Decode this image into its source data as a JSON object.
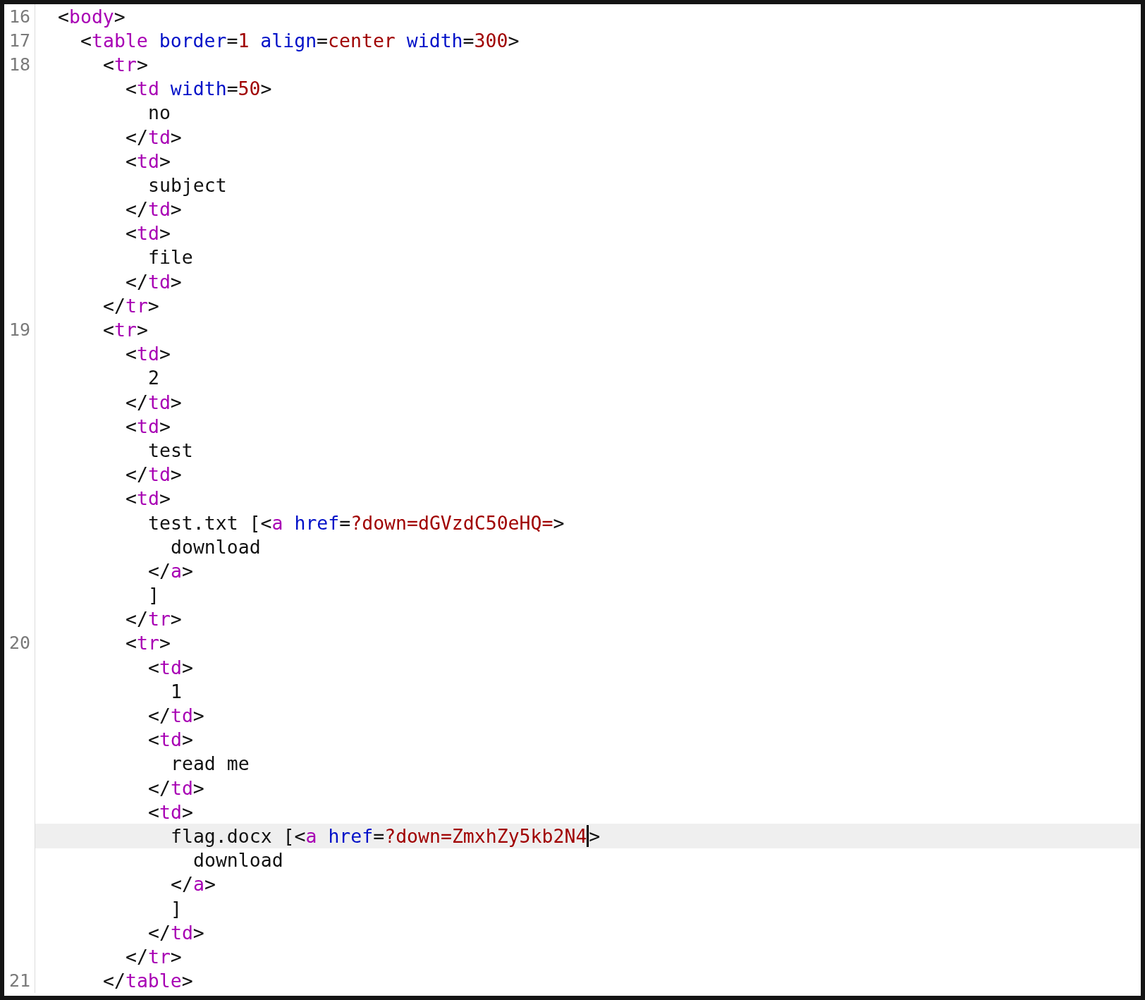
{
  "editor": {
    "lines": [
      {
        "number": "16",
        "current": false,
        "tokens": [
          {
            "kind": "plain",
            "text": "<"
          },
          {
            "kind": "tag",
            "text": "body"
          },
          {
            "kind": "plain",
            "text": ">"
          }
        ],
        "children": [
          {
            "number": "17",
            "current": false,
            "tokens": [
              {
                "kind": "plain",
                "text": "<"
              },
              {
                "kind": "tag",
                "text": "table"
              },
              {
                "kind": "attr",
                "text": "border"
              },
              {
                "kind": "plain",
                "text": "="
              },
              {
                "kind": "value",
                "text": "1"
              },
              {
                "kind": "attr",
                "text": "align"
              },
              {
                "kind": "plain",
                "text": "="
              },
              {
                "kind": "value",
                "text": "center"
              },
              {
                "kind": "attr",
                "text": "width"
              },
              {
                "kind": "plain",
                "text": "="
              },
              {
                "kind": "value",
                "text": "300"
              },
              {
                "kind": "plain",
                "text": ">"
              }
            ],
            "children": [
              {
                "number": "18",
                "current": false,
                "tokens": [
                  {
                    "kind": "plain",
                    "text": "<"
                  },
                  {
                    "kind": "tag",
                    "text": "tr"
                  },
                  {
                    "kind": "plain",
                    "text": ">"
                  }
                ],
                "children": [
                  {
                    "current": false,
                    "tokens": [
                      {
                        "kind": "plain",
                        "text": "<"
                      },
                      {
                        "kind": "tag",
                        "text": "td"
                      },
                      {
                        "kind": "attr",
                        "text": "width"
                      },
                      {
                        "kind": "plain",
                        "text": "="
                      },
                      {
                        "kind": "value",
                        "text": "50"
                      },
                      {
                        "kind": "plain",
                        "text": ">"
                      }
                    ],
                    "children": [
                      {
                        "current": false,
                        "tokens": [
                          {
                            "kind": "plain",
                            "text": "no"
                          }
                        ]
                      }
                    ]
                  },
                  {
                    "current": false,
                    "tokens": [
                      {
                        "kind": "plain",
                        "text": "</"
                      },
                      {
                        "kind": "tag",
                        "text": "td"
                      },
                      {
                        "kind": "plain",
                        "text": ">"
                      }
                    ]
                  },
                  {
                    "current": false,
                    "tokens": [
                      {
                        "kind": "plain",
                        "text": "<"
                      },
                      {
                        "kind": "tag",
                        "text": "td"
                      },
                      {
                        "kind": "plain",
                        "text": ">"
                      }
                    ],
                    "children": [
                      {
                        "current": false,
                        "tokens": [
                          {
                            "kind": "plain",
                            "text": "subject"
                          }
                        ]
                      }
                    ]
                  },
                  {
                    "current": false,
                    "tokens": [
                      {
                        "kind": "plain",
                        "text": "</"
                      },
                      {
                        "kind": "tag",
                        "text": "td"
                      },
                      {
                        "kind": "plain",
                        "text": ">"
                      }
                    ]
                  },
                  {
                    "current": false,
                    "tokens": [
                      {
                        "kind": "plain",
                        "text": "<"
                      },
                      {
                        "kind": "tag",
                        "text": "td"
                      },
                      {
                        "kind": "plain",
                        "text": ">"
                      }
                    ],
                    "children": [
                      {
                        "current": false,
                        "tokens": [
                          {
                            "kind": "plain",
                            "text": "file"
                          }
                        ]
                      }
                    ]
                  },
                  {
                    "current": false,
                    "tokens": [
                      {
                        "kind": "plain",
                        "text": "</"
                      },
                      {
                        "kind": "tag",
                        "text": "td"
                      },
                      {
                        "kind": "plain",
                        "text": ">"
                      }
                    ]
                  }
                ]
              },
              {
                "current": false,
                "tokens": [
                  {
                    "kind": "plain",
                    "text": "</"
                  },
                  {
                    "kind": "tag",
                    "text": "tr"
                  },
                  {
                    "kind": "plain",
                    "text": ">"
                  }
                ]
              },
              {
                "number": "19",
                "current": false,
                "tokens": [
                  {
                    "kind": "plain",
                    "text": "<"
                  },
                  {
                    "kind": "tag",
                    "text": "tr"
                  },
                  {
                    "kind": "plain",
                    "text": ">"
                  }
                ],
                "children": [
                  {
                    "current": false,
                    "tokens": [
                      {
                        "kind": "plain",
                        "text": "<"
                      },
                      {
                        "kind": "tag",
                        "text": "td"
                      },
                      {
                        "kind": "plain",
                        "text": ">"
                      }
                    ],
                    "children": [
                      {
                        "current": false,
                        "tokens": [
                          {
                            "kind": "plain",
                            "text": "2"
                          }
                        ]
                      }
                    ]
                  },
                  {
                    "current": false,
                    "tokens": [
                      {
                        "kind": "plain",
                        "text": "</"
                      },
                      {
                        "kind": "tag",
                        "text": "td"
                      },
                      {
                        "kind": "plain",
                        "text": ">"
                      }
                    ]
                  },
                  {
                    "current": false,
                    "tokens": [
                      {
                        "kind": "plain",
                        "text": "<"
                      },
                      {
                        "kind": "tag",
                        "text": "td"
                      },
                      {
                        "kind": "plain",
                        "text": ">"
                      }
                    ],
                    "children": [
                      {
                        "current": false,
                        "tokens": [
                          {
                            "kind": "plain",
                            "text": "test"
                          }
                        ]
                      }
                    ]
                  },
                  {
                    "current": false,
                    "tokens": [
                      {
                        "kind": "plain",
                        "text": "</"
                      },
                      {
                        "kind": "tag",
                        "text": "td"
                      },
                      {
                        "kind": "plain",
                        "text": ">"
                      }
                    ]
                  },
                  {
                    "current": false,
                    "tokens": [
                      {
                        "kind": "plain",
                        "text": "<"
                      },
                      {
                        "kind": "tag",
                        "text": "td"
                      },
                      {
                        "kind": "plain",
                        "text": ">"
                      }
                    ],
                    "children": [
                      {
                        "current": false,
                        "tokens": [
                          {
                            "kind": "plain",
                            "text": "test.txt [<"
                          },
                          {
                            "kind": "tag",
                            "text": "a"
                          },
                          {
                            "kind": "attr",
                            "text": "href"
                          },
                          {
                            "kind": "plain",
                            "text": "="
                          },
                          {
                            "kind": "value",
                            "text": "?down=dGVzdC50eHQ="
                          },
                          {
                            "kind": "plain",
                            "text": ">"
                          }
                        ],
                        "children": [
                          {
                            "current": false,
                            "tokens": [
                              {
                                "kind": "plain",
                                "text": "download"
                              }
                            ]
                          }
                        ]
                      },
                      {
                        "current": false,
                        "tokens": [
                          {
                            "kind": "plain",
                            "text": "</"
                          },
                          {
                            "kind": "tag",
                            "text": "a"
                          },
                          {
                            "kind": "plain",
                            "text": ">"
                          }
                        ]
                      },
                      {
                        "current": false,
                        "tokens": [
                          {
                            "kind": "plain",
                            "text": "]"
                          }
                        ]
                      }
                    ]
                  },
                  {
                    "current": false,
                    "tokens": [
                      {
                        "kind": "plain",
                        "text": "</"
                      },
                      {
                        "kind": "tag",
                        "text": "tr"
                      },
                      {
                        "kind": "plain",
                        "text": ">"
                      }
                    ]
                  },
                  {
                    "number": "20",
                    "current": false,
                    "tokens": [
                      {
                        "kind": "plain",
                        "text": "<"
                      },
                      {
                        "kind": "tag",
                        "text": "tr"
                      },
                      {
                        "kind": "plain",
                        "text": ">"
                      }
                    ],
                    "children": [
                      {
                        "current": false,
                        "tokens": [
                          {
                            "kind": "plain",
                            "text": "<"
                          },
                          {
                            "kind": "tag",
                            "text": "td"
                          },
                          {
                            "kind": "plain",
                            "text": ">"
                          }
                        ],
                        "children": [
                          {
                            "current": false,
                            "tokens": [
                              {
                                "kind": "plain",
                                "text": "1"
                              }
                            ]
                          }
                        ]
                      },
                      {
                        "current": false,
                        "tokens": [
                          {
                            "kind": "plain",
                            "text": "</"
                          },
                          {
                            "kind": "tag",
                            "text": "td"
                          },
                          {
                            "kind": "plain",
                            "text": ">"
                          }
                        ]
                      },
                      {
                        "current": false,
                        "tokens": [
                          {
                            "kind": "plain",
                            "text": "<"
                          },
                          {
                            "kind": "tag",
                            "text": "td"
                          },
                          {
                            "kind": "plain",
                            "text": ">"
                          }
                        ],
                        "children": [
                          {
                            "current": false,
                            "tokens": [
                              {
                                "kind": "plain",
                                "text": "read me"
                              }
                            ]
                          }
                        ]
                      },
                      {
                        "current": false,
                        "tokens": [
                          {
                            "kind": "plain",
                            "text": "</"
                          },
                          {
                            "kind": "tag",
                            "text": "td"
                          },
                          {
                            "kind": "plain",
                            "text": ">"
                          }
                        ]
                      },
                      {
                        "current": false,
                        "tokens": [
                          {
                            "kind": "plain",
                            "text": "<"
                          },
                          {
                            "kind": "tag",
                            "text": "td"
                          },
                          {
                            "kind": "plain",
                            "text": ">"
                          }
                        ],
                        "children": [
                          {
                            "current": true,
                            "tokens": [
                              {
                                "kind": "plain",
                                "text": "flag.docx [<"
                              },
                              {
                                "kind": "tag",
                                "text": "a"
                              },
                              {
                                "kind": "attr",
                                "text": "href"
                              },
                              {
                                "kind": "plain",
                                "text": "="
                              },
                              {
                                "kind": "value",
                                "text": "?down=ZmxhZy5kb2N4",
                                "caret_after": true
                              },
                              {
                                "kind": "plain",
                                "text": ">"
                              }
                            ],
                            "children": [
                              {
                                "current": false,
                                "tokens": [
                                  {
                                    "kind": "plain",
                                    "text": "download"
                                  }
                                ]
                              }
                            ]
                          },
                          {
                            "current": false,
                            "tokens": [
                              {
                                "kind": "plain",
                                "text": "</"
                              },
                              {
                                "kind": "tag",
                                "text": "a"
                              },
                              {
                                "kind": "plain",
                                "text": ">"
                              }
                            ]
                          },
                          {
                            "current": false,
                            "tokens": [
                              {
                                "kind": "plain",
                                "text": "]"
                              }
                            ]
                          }
                        ]
                      },
                      {
                        "current": false,
                        "tokens": [
                          {
                            "kind": "plain",
                            "text": "</"
                          },
                          {
                            "kind": "tag",
                            "text": "td"
                          },
                          {
                            "kind": "plain",
                            "text": ">"
                          }
                        ]
                      }
                    ]
                  },
                  {
                    "current": false,
                    "tokens": [
                      {
                        "kind": "plain",
                        "text": "</"
                      },
                      {
                        "kind": "tag",
                        "text": "tr"
                      },
                      {
                        "kind": "plain",
                        "text": ">"
                      }
                    ]
                  }
                ]
              },
              {
                "number": "21",
                "current": false,
                "tokens": [
                  {
                    "kind": "plain",
                    "text": "</"
                  },
                  {
                    "kind": "tag",
                    "text": "table"
                  },
                  {
                    "kind": "plain",
                    "text": ">"
                  }
                ]
              }
            ]
          }
        ]
      }
    ]
  }
}
